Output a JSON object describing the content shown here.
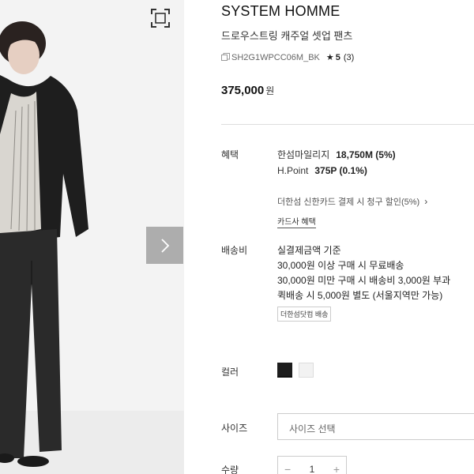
{
  "product": {
    "brand": "SYSTEM HOMME",
    "name": "드로우스트링 캐주얼 셋업 팬츠",
    "code": "SH2G1WPCC06M_BK",
    "rating": "5",
    "review_count": "(3)",
    "price": "375,000",
    "currency": "원"
  },
  "benefits": {
    "label": "혜택",
    "mileage_label": "한섬마일리지",
    "mileage_value": "18,750M (5%)",
    "hpoint_label": "H.Point",
    "hpoint_value": "375P (0.1%)",
    "card_discount": "더한섬 신한카드 결제 시 청구 할인(5%)",
    "card_benefit_link": "카드사 혜택"
  },
  "shipping": {
    "label": "배송비",
    "lines": [
      "실결제금액 기준",
      "30,000원 이상 구매 시 무료배송",
      "30,000원 미만 구매 시 배송비 3,000원 부과",
      "퀵배송 시 5,000원 별도 (서울지역만 가능)"
    ],
    "tag": "더한섬닷컴 배송"
  },
  "color": {
    "label": "컬러",
    "options": [
      "black",
      "white"
    ],
    "colors": {
      "black": "#1d1d1d",
      "white": "#f2f2f2"
    }
  },
  "size": {
    "label": "사이즈",
    "placeholder": "사이즈 선택"
  },
  "quantity": {
    "label": "수량",
    "minus": "−",
    "value": "1",
    "plus": "+"
  },
  "icons": {
    "zoom": "fullscreen-icon",
    "next": "chevron-right-icon",
    "copy": "copy-icon",
    "star": "★",
    "card_chevron": "›"
  }
}
